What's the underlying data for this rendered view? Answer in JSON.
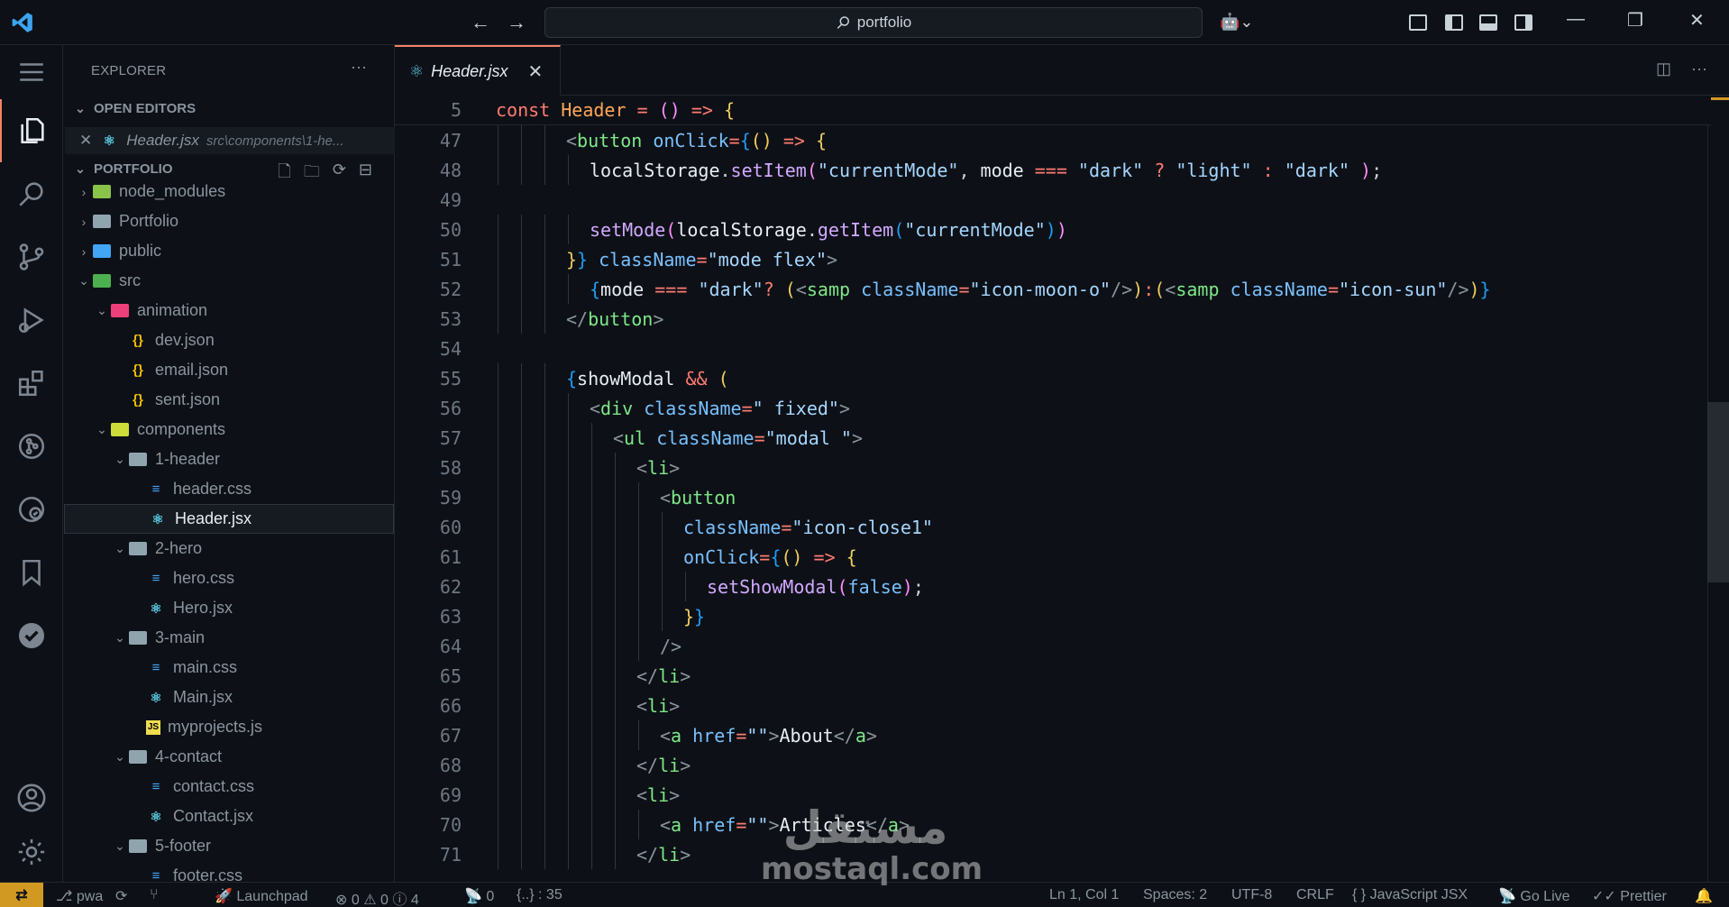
{
  "titlebar": {
    "search_text": "portfolio",
    "nav_back": "←",
    "nav_forward": "→",
    "copilot": "⌘",
    "minimize": "—",
    "restore": "❐",
    "close": "✕"
  },
  "sidebar": {
    "title": "EXPLORER",
    "more": "···",
    "open_editors_label": "OPEN EDITORS",
    "open_editor": {
      "name": "Header.jsx",
      "path": "src\\components\\1-he..."
    },
    "project_label": "PORTFOLIO",
    "tree": [
      {
        "label": "node_modules",
        "depth": 0,
        "kind": "folder",
        "color": "#8bc34a",
        "chevron": "›"
      },
      {
        "label": "Portfolio",
        "depth": 0,
        "kind": "folder",
        "color": "#90a4ae",
        "chevron": "›"
      },
      {
        "label": "public",
        "depth": 0,
        "kind": "folder",
        "color": "#42a5f5",
        "chevron": "›"
      },
      {
        "label": "src",
        "depth": 0,
        "kind": "folder",
        "color": "#4caf50",
        "chevron": "⌄"
      },
      {
        "label": "animation",
        "depth": 1,
        "kind": "folder",
        "color": "#ec407a",
        "chevron": "⌄"
      },
      {
        "label": "dev.json",
        "depth": 2,
        "kind": "json"
      },
      {
        "label": "email.json",
        "depth": 2,
        "kind": "json"
      },
      {
        "label": "sent.json",
        "depth": 2,
        "kind": "json"
      },
      {
        "label": "components",
        "depth": 1,
        "kind": "folder",
        "color": "#cddc39",
        "chevron": "⌄"
      },
      {
        "label": "1-header",
        "depth": 2,
        "kind": "folder",
        "color": "#90a4ae",
        "chevron": "⌄"
      },
      {
        "label": "header.css",
        "depth": 3,
        "kind": "css"
      },
      {
        "label": "Header.jsx",
        "depth": 3,
        "kind": "react",
        "selected": true
      },
      {
        "label": "2-hero",
        "depth": 2,
        "kind": "folder",
        "color": "#90a4ae",
        "chevron": "⌄"
      },
      {
        "label": "hero.css",
        "depth": 3,
        "kind": "css"
      },
      {
        "label": "Hero.jsx",
        "depth": 3,
        "kind": "react"
      },
      {
        "label": "3-main",
        "depth": 2,
        "kind": "folder",
        "color": "#90a4ae",
        "chevron": "⌄"
      },
      {
        "label": "main.css",
        "depth": 3,
        "kind": "css"
      },
      {
        "label": "Main.jsx",
        "depth": 3,
        "kind": "react"
      },
      {
        "label": "myprojects.js",
        "depth": 3,
        "kind": "js"
      },
      {
        "label": "4-contact",
        "depth": 2,
        "kind": "folder",
        "color": "#90a4ae",
        "chevron": "⌄"
      },
      {
        "label": "contact.css",
        "depth": 3,
        "kind": "css"
      },
      {
        "label": "Contact.jsx",
        "depth": 3,
        "kind": "react"
      },
      {
        "label": "5-footer",
        "depth": 2,
        "kind": "folder",
        "color": "#90a4ae",
        "chevron": "⌄"
      },
      {
        "label": "footer.css",
        "depth": 3,
        "kind": "css"
      }
    ]
  },
  "tab": {
    "label": "Header.jsx",
    "close": "✕"
  },
  "editor": {
    "sticky": {
      "num": "5",
      "html": "<span class='kw'>const</span> <span class='gold'>Header</span> <span class='kw'>=</span> <span class='br2'>()</span> <span class='kw'>=&gt;</span> <span class='br'>{</span>"
    },
    "lines": [
      {
        "num": "47",
        "indent": 3,
        "html": "<span class='pn'>&lt;</span><span class='tag'>button</span> <span class='attr'>onClick</span><span class='kw'>=</span><span class='br3'>{</span><span class='br'>()</span> <span class='kw'>=&gt;</span> <span class='br'>{</span>"
      },
      {
        "num": "48",
        "indent": 4,
        "html": "<span class='txt'>localStorage</span>.<span class='fn'>setItem</span><span class='br2'>(</span><span class='str'>\"currentMode\"</span>, <span class='txt'>mode</span> <span class='kw'>===</span> <span class='str'>\"dark\"</span> <span class='kw'>?</span> <span class='str'>\"light\"</span> <span class='kw'>:</span> <span class='str'>\"dark\"</span> <span class='br2'>)</span>;"
      },
      {
        "num": "49",
        "indent": 0,
        "html": ""
      },
      {
        "num": "50",
        "indent": 4,
        "html": "<span class='fn'>setMode</span><span class='br2'>(</span><span class='txt'>localStorage</span>.<span class='fn'>getItem</span><span class='br3'>(</span><span class='str'>\"currentMode\"</span><span class='br3'>)</span><span class='br2'>)</span>"
      },
      {
        "num": "51",
        "indent": 3,
        "html": "<span class='br'>}</span><span class='br3'>}</span> <span class='attr'>className</span><span class='kw'>=</span><span class='str'>\"mode flex\"</span><span class='pn'>&gt;</span>"
      },
      {
        "num": "52",
        "indent": 4,
        "html": "<span class='br3'>{</span><span class='txt'>mode</span> <span class='kw'>===</span> <span class='str'>\"dark\"</span><span class='kw'>?</span> <span class='br'>(</span><span class='pn'>&lt;</span><span class='tag'>samp</span> <span class='attr'>className</span><span class='kw'>=</span><span class='str'>\"icon-moon-o\"</span><span class='pn'>/&gt;</span><span class='br'>)</span><span class='kw'>:</span><span class='br'>(</span><span class='pn'>&lt;</span><span class='tag'>samp</span> <span class='attr'>className</span><span class='kw'>=</span><span class='str'>\"icon-sun\"</span><span class='pn'>/&gt;</span><span class='br'>)</span><span class='br3'>}</span>"
      },
      {
        "num": "53",
        "indent": 3,
        "html": "<span class='pn'>&lt;/</span><span class='tag'>button</span><span class='pn'>&gt;</span>"
      },
      {
        "num": "54",
        "indent": 0,
        "html": ""
      },
      {
        "num": "55",
        "indent": 3,
        "html": "<span class='br3'>{</span><span class='txt'>showModal</span> <span class='kw'>&amp;&amp;</span> <span class='br'>(</span>"
      },
      {
        "num": "56",
        "indent": 4,
        "html": "<span class='pn'>&lt;</span><span class='tag'>div</span> <span class='attr'>className</span><span class='kw'>=</span><span class='str'>\" fixed\"</span><span class='pn'>&gt;</span>"
      },
      {
        "num": "57",
        "indent": 5,
        "html": "<span class='pn'>&lt;</span><span class='tag'>ul</span> <span class='attr'>className</span><span class='kw'>=</span><span class='str'>\"modal \"</span><span class='pn'>&gt;</span>"
      },
      {
        "num": "58",
        "indent": 6,
        "html": "<span class='pn'>&lt;</span><span class='tag'>li</span><span class='pn'>&gt;</span>"
      },
      {
        "num": "59",
        "indent": 7,
        "html": "<span class='pn'>&lt;</span><span class='tag'>button</span>"
      },
      {
        "num": "60",
        "indent": 8,
        "html": "<span class='attr'>className</span><span class='kw'>=</span><span class='str'>\"icon-close1\"</span>"
      },
      {
        "num": "61",
        "indent": 8,
        "html": "<span class='attr'>onClick</span><span class='kw'>=</span><span class='br3'>{</span><span class='br'>()</span> <span class='kw'>=&gt;</span> <span class='br'>{</span>"
      },
      {
        "num": "62",
        "indent": 9,
        "html": "<span class='fn'>setShowModal</span><span class='br2'>(</span><span class='attr'>false</span><span class='br2'>)</span>;"
      },
      {
        "num": "63",
        "indent": 8,
        "html": "<span class='br'>}</span><span class='br3'>}</span>"
      },
      {
        "num": "64",
        "indent": 7,
        "html": "<span class='pn'>/&gt;</span>"
      },
      {
        "num": "65",
        "indent": 6,
        "html": "<span class='pn'>&lt;/</span><span class='tag'>li</span><span class='pn'>&gt;</span>"
      },
      {
        "num": "66",
        "indent": 6,
        "html": "<span class='pn'>&lt;</span><span class='tag'>li</span><span class='pn'>&gt;</span>"
      },
      {
        "num": "67",
        "indent": 7,
        "html": "<span class='pn'>&lt;</span><span class='tag'>a</span> <span class='attr'>href</span><span class='kw'>=</span><span class='str'>\"\"</span><span class='pn'>&gt;</span><span class='txt'>About</span><span class='pn'>&lt;/</span><span class='tag'>a</span><span class='pn'>&gt;</span>"
      },
      {
        "num": "68",
        "indent": 6,
        "html": "<span class='pn'>&lt;/</span><span class='tag'>li</span><span class='pn'>&gt;</span>"
      },
      {
        "num": "69",
        "indent": 6,
        "html": "<span class='pn'>&lt;</span><span class='tag'>li</span><span class='pn'>&gt;</span>"
      },
      {
        "num": "70",
        "indent": 7,
        "html": "<span class='pn'>&lt;</span><span class='tag'>a</span> <span class='attr'>href</span><span class='kw'>=</span><span class='str'>\"\"</span><span class='pn'>&gt;</span><span class='txt'>Articles</span><span class='pn'>&lt;/</span><span class='tag'>a</span><span class='pn'>&gt;</span>"
      },
      {
        "num": "71",
        "indent": 6,
        "html": "<span class='pn'>&lt;/</span><span class='tag'>li</span><span class='pn'>&gt;</span>"
      }
    ]
  },
  "watermark": {
    "arabic": "مستقل",
    "latin": "mostaql.com"
  },
  "statusbar": {
    "branch": "pwa",
    "launchpad": "Launchpad",
    "errors": "0",
    "warnings": "0",
    "infos": "4",
    "ports": "0",
    "selection": "{..} : 35",
    "position": "Ln 1, Col 1",
    "spaces": "Spaces: 2",
    "encoding": "UTF-8",
    "eol": "CRLF",
    "language": "{ } JavaScript JSX",
    "golive": "Go Live",
    "prettier": "Prettier"
  },
  "colors": {
    "accent": "#f78166",
    "remote": "#d29922",
    "folder_src": "#4caf50",
    "react": "#58c4dc",
    "css": "#42a5f5",
    "json": "#f0c000",
    "js": "#f0db4f"
  }
}
